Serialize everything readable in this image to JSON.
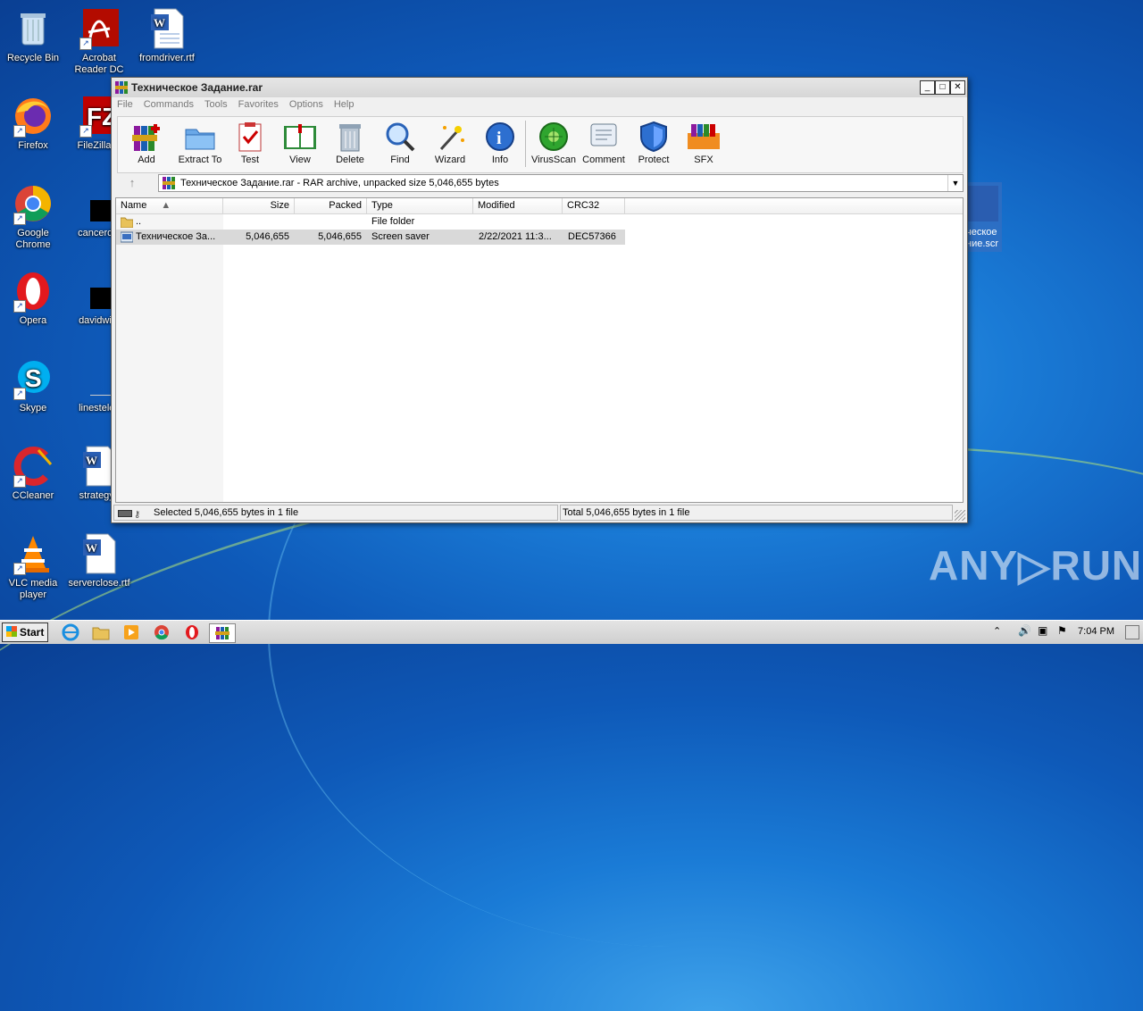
{
  "desktop": {
    "icons": [
      {
        "label": "Recycle Bin"
      },
      {
        "label": "Acrobat Reader DC"
      },
      {
        "label": "fromdriver.rtf"
      },
      {
        "label": "Firefox"
      },
      {
        "label": "FileZilla C"
      },
      {
        "label": "Google Chrome"
      },
      {
        "label": "cancerdel"
      },
      {
        "label": "Opera"
      },
      {
        "label": "davidwife"
      },
      {
        "label": "Skype"
      },
      {
        "label": "linestelev"
      },
      {
        "label": "CCleaner"
      },
      {
        "label": "strategyy"
      },
      {
        "label": "VLC media player"
      },
      {
        "label": "serverclose.rtf"
      },
      {
        "label": "ческое ние.scr"
      }
    ]
  },
  "window": {
    "title": "Техническое Задание.rar",
    "menu": [
      "File",
      "Commands",
      "Tools",
      "Favorites",
      "Options",
      "Help"
    ],
    "toolbar": [
      "Add",
      "Extract To",
      "Test",
      "View",
      "Delete",
      "Find",
      "Wizard",
      "Info",
      "VirusScan",
      "Comment",
      "Protect",
      "SFX"
    ],
    "address": "Техническое Задание.rar - RAR archive, unpacked size 5,046,655 bytes",
    "columns": [
      "Name",
      "Size",
      "Packed",
      "Type",
      "Modified",
      "CRC32"
    ],
    "rows": [
      {
        "name": "..",
        "size": "",
        "packed": "",
        "type": "File folder",
        "modified": "",
        "crc": ""
      },
      {
        "name": "Техническое За...",
        "size": "5,046,655",
        "packed": "5,046,655",
        "type": "Screen saver",
        "modified": "2/22/2021 11:3...",
        "crc": "DEC57366"
      }
    ],
    "status_left": "Selected 5,046,655 bytes in 1 file",
    "status_right": "Total 5,046,655 bytes in 1 file"
  },
  "taskbar": {
    "start_label": "Start",
    "clock": "7:04 PM"
  },
  "watermark": "ANY▷RUN",
  "colors": {
    "accent": "#0e59b8",
    "window_bg": "#f0f0f0",
    "selection": "#d9d9d9"
  }
}
